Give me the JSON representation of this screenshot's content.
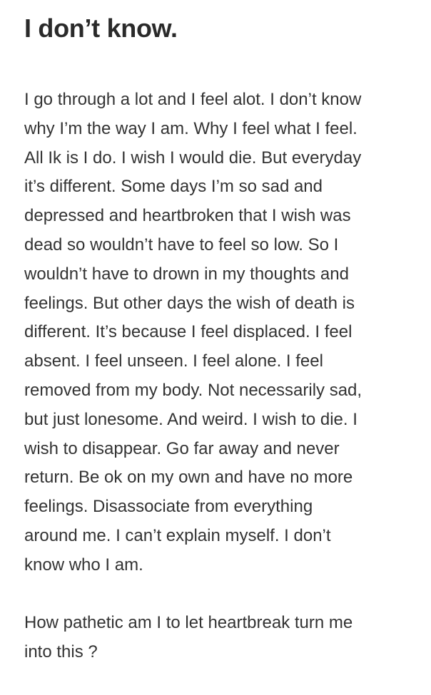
{
  "note": {
    "title": "I don’t know.",
    "paragraphs": [
      "I go through a lot and I feel alot. I don’t know\nwhy I’m the way I am. Why I feel what I feel.\nAll Ik is I do. I wish I would die. But everyday\nit’s different. Some days I’m so sad and\ndepressed and heartbroken that I wish was\ndead so wouldn’t have to feel so low. So I\nwouldn’t have to drown in my thoughts and\nfeelings. But other days the wish of death is\ndifferent. It’s because I feel displaced. I feel\nabsent. I feel unseen. I feel alone. I feel\nremoved from my body. Not necessarily sad,\nbut just lonesome. And weird. I wish to die. I\nwish to disappear. Go far away and never\nreturn. Be ok on my own and have no more\nfeelings. Disassociate from everything\naround me. I can’t explain myself. I don’t\nknow who I am.",
      "How pathetic am I to let heartbreak turn me\ninto this ?"
    ]
  },
  "colors": {
    "background": "#ffffff",
    "title_text": "#2a2a2a",
    "body_text": "#333333"
  }
}
